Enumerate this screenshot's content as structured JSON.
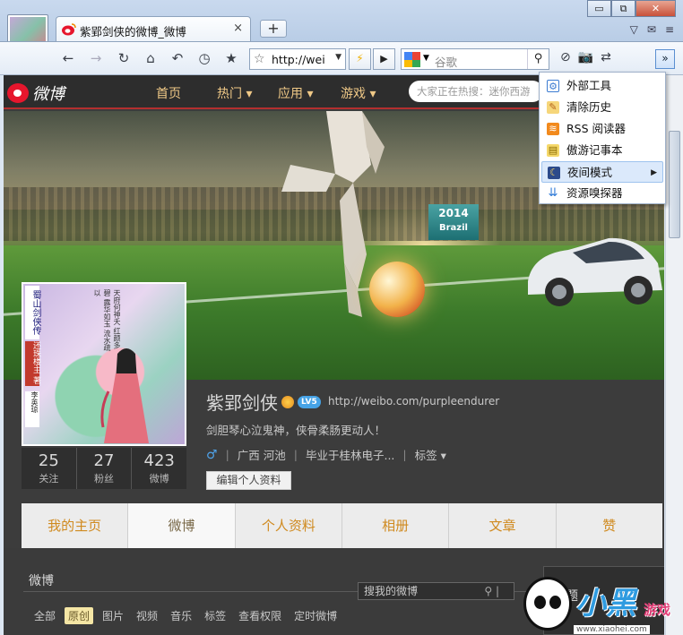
{
  "browser": {
    "tab_title": "紫郢剑侠的微博_微博",
    "tab_close": "×",
    "new_tab": "+",
    "address_text": "http://wei",
    "search_placeholder": "谷歌",
    "window_min": "▭",
    "window_restore": "⧉",
    "window_close": "✕"
  },
  "menu": {
    "items": [
      {
        "label": "外部工具",
        "icon": "external-tools-icon"
      },
      {
        "label": "清除历史",
        "icon": "clear-history-icon"
      },
      {
        "label": "RSS 阅读器",
        "icon": "rss-icon"
      },
      {
        "label": "傲游记事本",
        "icon": "notepad-icon"
      },
      {
        "label": "夜间模式",
        "icon": "night-mode-icon",
        "highlighted": true
      },
      {
        "label": "资源嗅探器",
        "icon": "resource-sniffer-icon"
      }
    ]
  },
  "weibo": {
    "logo_text": "微博",
    "nav": [
      "首页",
      "热门",
      "应用",
      "游戏"
    ],
    "search_placeholder": "大家正在热搜：迷你西游",
    "banner_sign": "2014",
    "banner_sign2": "Brazil",
    "avatar_title": "蜀山剑侠传",
    "avatar_author": "还珠楼主 著",
    "avatar_illustrator": "李英琼",
    "avatar_poem": "天府何神夭 红颜多碧 露华如玉 流水疏以",
    "profile": {
      "name": "紫郢剑侠",
      "level_badge": "LV5",
      "url": "http://weibo.com/purpleendurer",
      "bio": "剑胆琴心泣鬼神，侠骨柔肠更动人！",
      "gender": "♂",
      "location": "广西 河池",
      "school": "毕业于桂林电子...",
      "tags": "标签 ▾",
      "edit_button": "编辑个人资料"
    },
    "stats": [
      {
        "num": "25",
        "label": "关注"
      },
      {
        "num": "27",
        "label": "粉丝"
      },
      {
        "num": "423",
        "label": "微博"
      }
    ],
    "tabs": [
      "我的主页",
      "微博",
      "个人资料",
      "相册",
      "文章",
      "赞"
    ],
    "feed": {
      "title": "微博",
      "search_placeholder": "搜我的微博",
      "filters": [
        "全部",
        "原创",
        "图片",
        "视频",
        "音乐",
        "标签",
        "查看权限",
        "定时微博"
      ],
      "right_label": "话题"
    }
  },
  "watermark": {
    "big": "小黑",
    "game": "游戏",
    "site": "www.xiaohei.com"
  }
}
